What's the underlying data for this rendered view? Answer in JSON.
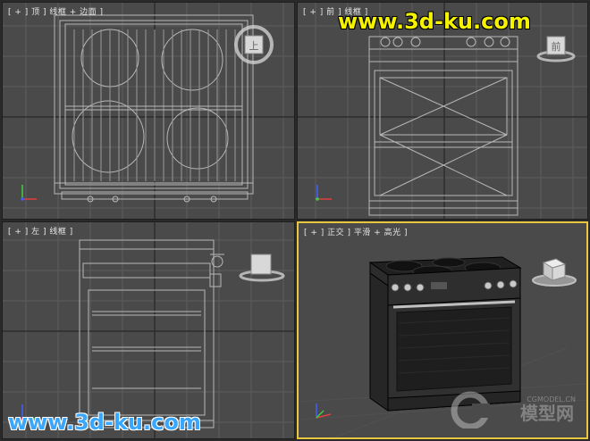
{
  "viewports": {
    "top": {
      "label": "[ + ] 顶 ] 线框 + 边面 ]",
      "cube_face": "上"
    },
    "front": {
      "label": "[ + ] 前 ] 线框 ]",
      "cube_face": "前"
    },
    "left": {
      "label": "[ + ] 左 ] 线框 ]",
      "cube_face": ""
    },
    "persp": {
      "label": "[ + ] 正交 ] 平滑 + 高光 ]",
      "cube_face": ""
    }
  },
  "watermarks": {
    "top_right": "www.3d-ku.com",
    "bottom_left": "www.3d-ku.com",
    "cg_site": "CGMODEL.CN",
    "cg_brand": "模型网"
  },
  "colors": {
    "viewport_bg": "#4a4a4a",
    "grid": "#5c5c5c",
    "wire": "#b4b4b4",
    "active_border": "#e8c640",
    "watermark_yellow": "#f5f200",
    "watermark_blue": "#3aa7ff"
  },
  "icons": [
    "viewcube-icon",
    "axis-gizmo-icon",
    "stove-model"
  ]
}
